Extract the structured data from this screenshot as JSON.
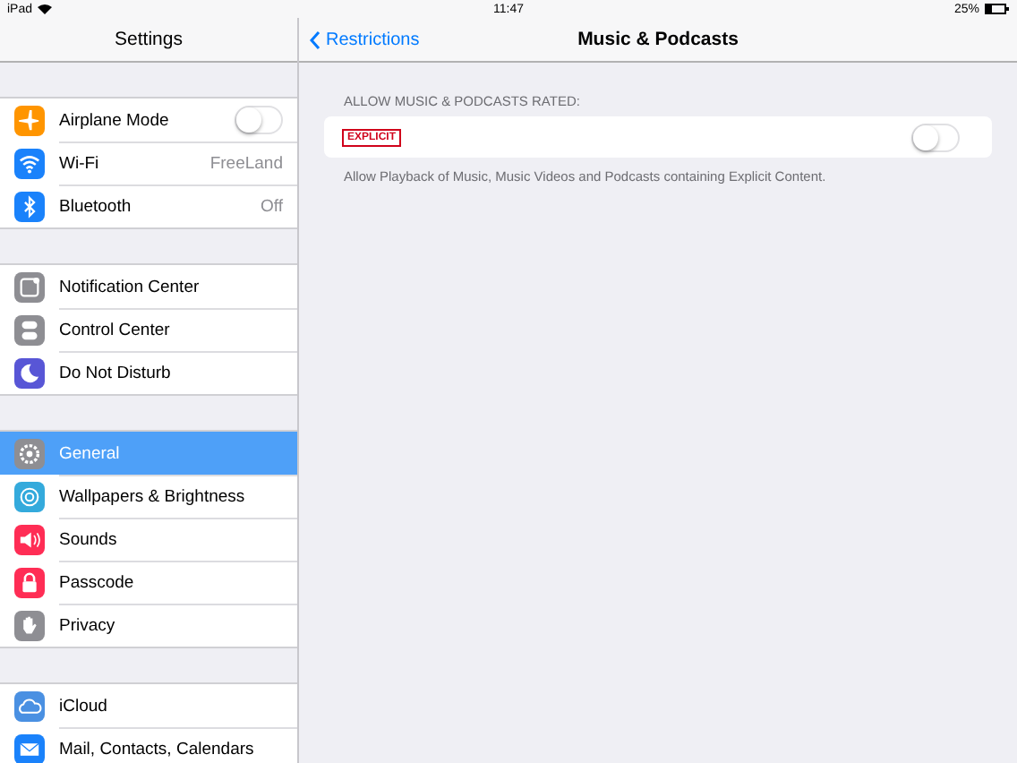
{
  "status_bar": {
    "device": "iPad",
    "time": "11:47",
    "battery": "25%"
  },
  "sidebar": {
    "title": "Settings",
    "groups": [
      {
        "items": [
          {
            "label": "Airplane Mode",
            "kind": "toggle",
            "on": false,
            "selected": false,
            "color": "#ff9500"
          },
          {
            "label": "Wi-Fi",
            "kind": "value",
            "value": "FreeLand",
            "selected": false,
            "color": "#1a82fb"
          },
          {
            "label": "Bluetooth",
            "kind": "value",
            "value": "Off",
            "selected": false,
            "color": "#1a82fb"
          }
        ]
      },
      {
        "items": [
          {
            "label": "Notification Center",
            "kind": "plain",
            "selected": false,
            "color": "#8e8e93"
          },
          {
            "label": "Control Center",
            "kind": "plain",
            "selected": false,
            "color": "#8e8e93"
          },
          {
            "label": "Do Not Disturb",
            "kind": "plain",
            "selected": false,
            "color": "#5856d6"
          }
        ]
      },
      {
        "items": [
          {
            "label": "General",
            "kind": "plain",
            "selected": true,
            "color": "#8e8e93"
          },
          {
            "label": "Wallpapers & Brightness",
            "kind": "plain",
            "selected": false,
            "color": "#34aadc"
          },
          {
            "label": "Sounds",
            "kind": "plain",
            "selected": false,
            "color": "#ff2d55"
          },
          {
            "label": "Passcode",
            "kind": "plain",
            "selected": false,
            "color": "#ff2d55"
          },
          {
            "label": "Privacy",
            "kind": "plain",
            "selected": false,
            "color": "#8e8e93"
          }
        ]
      },
      {
        "items": [
          {
            "label": "iCloud",
            "kind": "plain",
            "selected": false,
            "color": "#4a90e2"
          },
          {
            "label": "Mail, Contacts, Calendars",
            "kind": "plain",
            "selected": false,
            "color": "#1a82fb"
          }
        ]
      }
    ]
  },
  "detail": {
    "back": "Restrictions",
    "title": "Music & Podcasts",
    "section_header": "ALLOW MUSIC & PODCASTS RATED:",
    "row": {
      "badge": "EXPLICIT",
      "on": false
    },
    "footer": "Allow Playback of Music, Music Videos and Podcasts containing Explicit Content."
  }
}
